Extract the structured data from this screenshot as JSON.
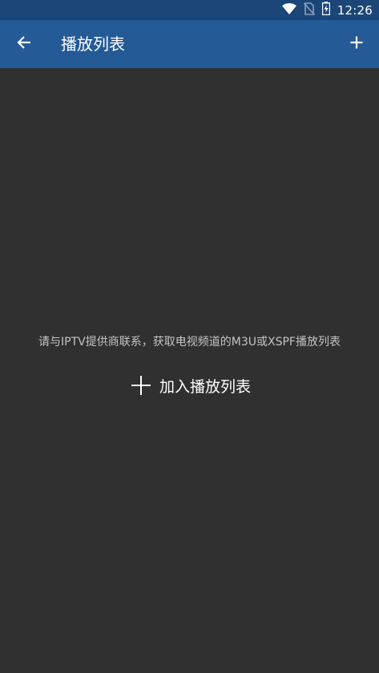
{
  "status_bar": {
    "time": "12:26",
    "icons": [
      "wifi-icon",
      "no-sim-icon",
      "battery-charging-icon"
    ]
  },
  "app_bar": {
    "title": "播放列表",
    "back_icon": "arrow-back-icon",
    "add_icon": "plus-icon"
  },
  "main": {
    "hint": "请与IPTV提供商联系，获取电视频道的M3U或XSPF播放列表",
    "add_label": "加入播放列表",
    "add_icon": "plus-icon"
  },
  "colors": {
    "status_bar": "#1b4677",
    "app_bar": "#245a96",
    "background": "#303030",
    "hint_text": "#c4c4c4",
    "text": "#ffffff"
  }
}
